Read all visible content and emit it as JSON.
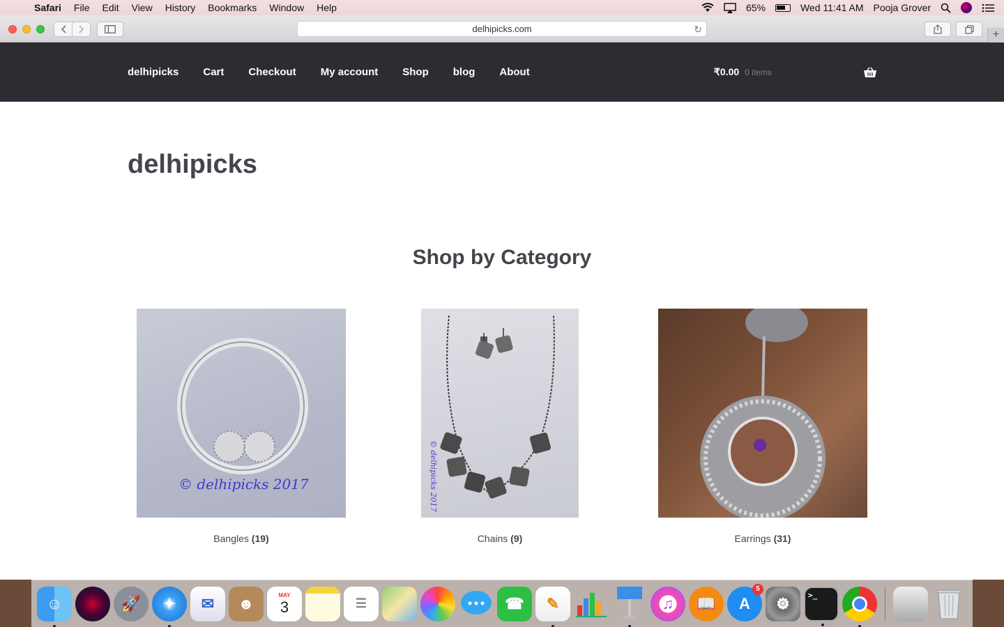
{
  "menubar": {
    "app": "Safari",
    "items": [
      "File",
      "Edit",
      "View",
      "History",
      "Bookmarks",
      "Window",
      "Help"
    ],
    "battery": "65%",
    "clock": "Wed 11:41 AM",
    "user": "Pooja Grover"
  },
  "browser": {
    "url": "delhipicks.com"
  },
  "site": {
    "nav": [
      "delhipicks",
      "Cart",
      "Checkout",
      "My account",
      "Shop",
      "blog",
      "About"
    ],
    "cart_amount": "₹0.00",
    "cart_items": "0 items",
    "title": "delhipicks",
    "section_title": "Shop by Category",
    "categories": [
      {
        "name": "Bangles",
        "count": "(19)",
        "watermark": "© delhipicks 2017"
      },
      {
        "name": "Chains",
        "count": "(9)",
        "watermark": "© delhipicks 2017"
      },
      {
        "name": "Earrings",
        "count": "(31)"
      }
    ]
  },
  "dock": {
    "calendar_month": "MAY",
    "calendar_day": "3",
    "appstore_badge": "5"
  },
  "colors": {
    "header_bg": "#2c2d33",
    "text": "#43454b"
  }
}
